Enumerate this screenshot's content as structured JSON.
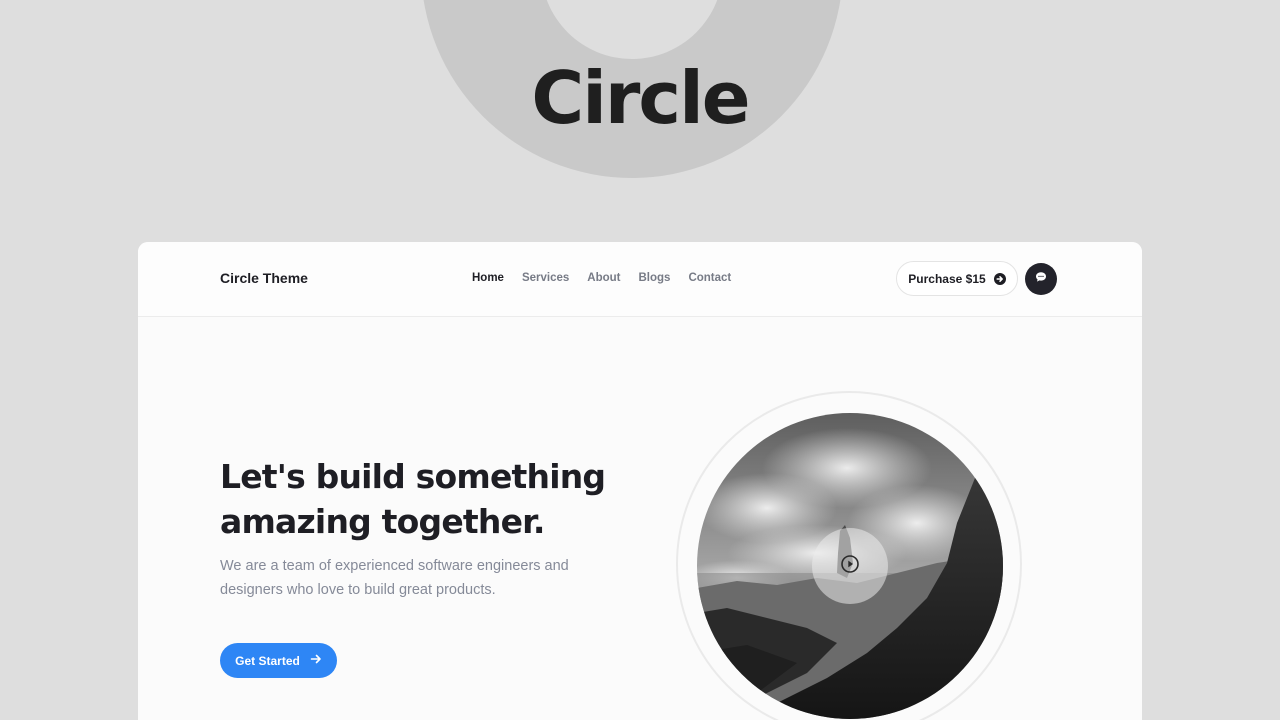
{
  "banner": {
    "title": "Circle"
  },
  "nav": {
    "logo": "Circle Theme",
    "items": [
      {
        "label": "Home",
        "active": true
      },
      {
        "label": "Services",
        "active": false
      },
      {
        "label": "About",
        "active": false
      },
      {
        "label": "Blogs",
        "active": false
      },
      {
        "label": "Contact",
        "active": false
      }
    ],
    "purchase_label": "Purchase $15",
    "purchase_icon": "arrow-circle-right-icon",
    "chat_icon": "chat-bubble-icon"
  },
  "hero": {
    "title_line1": "Let's build something",
    "title_line2": "amazing together.",
    "desc_line1": "We are a team of experienced software engineers and",
    "desc_line2": "designers who love to build great products.",
    "cta_label": "Get Started",
    "cta_icon": "arrow-right-icon",
    "media_icon": "play-icon"
  },
  "colors": {
    "background": "#dedede",
    "accent": "#2e86f5",
    "dark": "#1e1e24",
    "muted": "#858a98"
  }
}
